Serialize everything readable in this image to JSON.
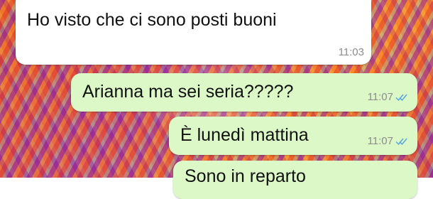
{
  "messages": [
    {
      "direction": "incoming",
      "text": "Ho visto che ci sono posti buoni",
      "time": "11:03",
      "read": false
    },
    {
      "direction": "outgoing",
      "text": "Arianna ma sei seria?????",
      "time": "11:07",
      "read": true
    },
    {
      "direction": "outgoing",
      "text": "È lunedì mattina",
      "time": "11:07",
      "read": true
    },
    {
      "direction": "outgoing",
      "text": "Sono in reparto",
      "time": "",
      "read": false
    }
  ],
  "colors": {
    "incoming_bubble": "#ffffff",
    "outgoing_bubble": "#dcf8c6",
    "read_ticks": "#4fa3e0"
  },
  "icons": {
    "read_ticks": "double-check-icon"
  }
}
